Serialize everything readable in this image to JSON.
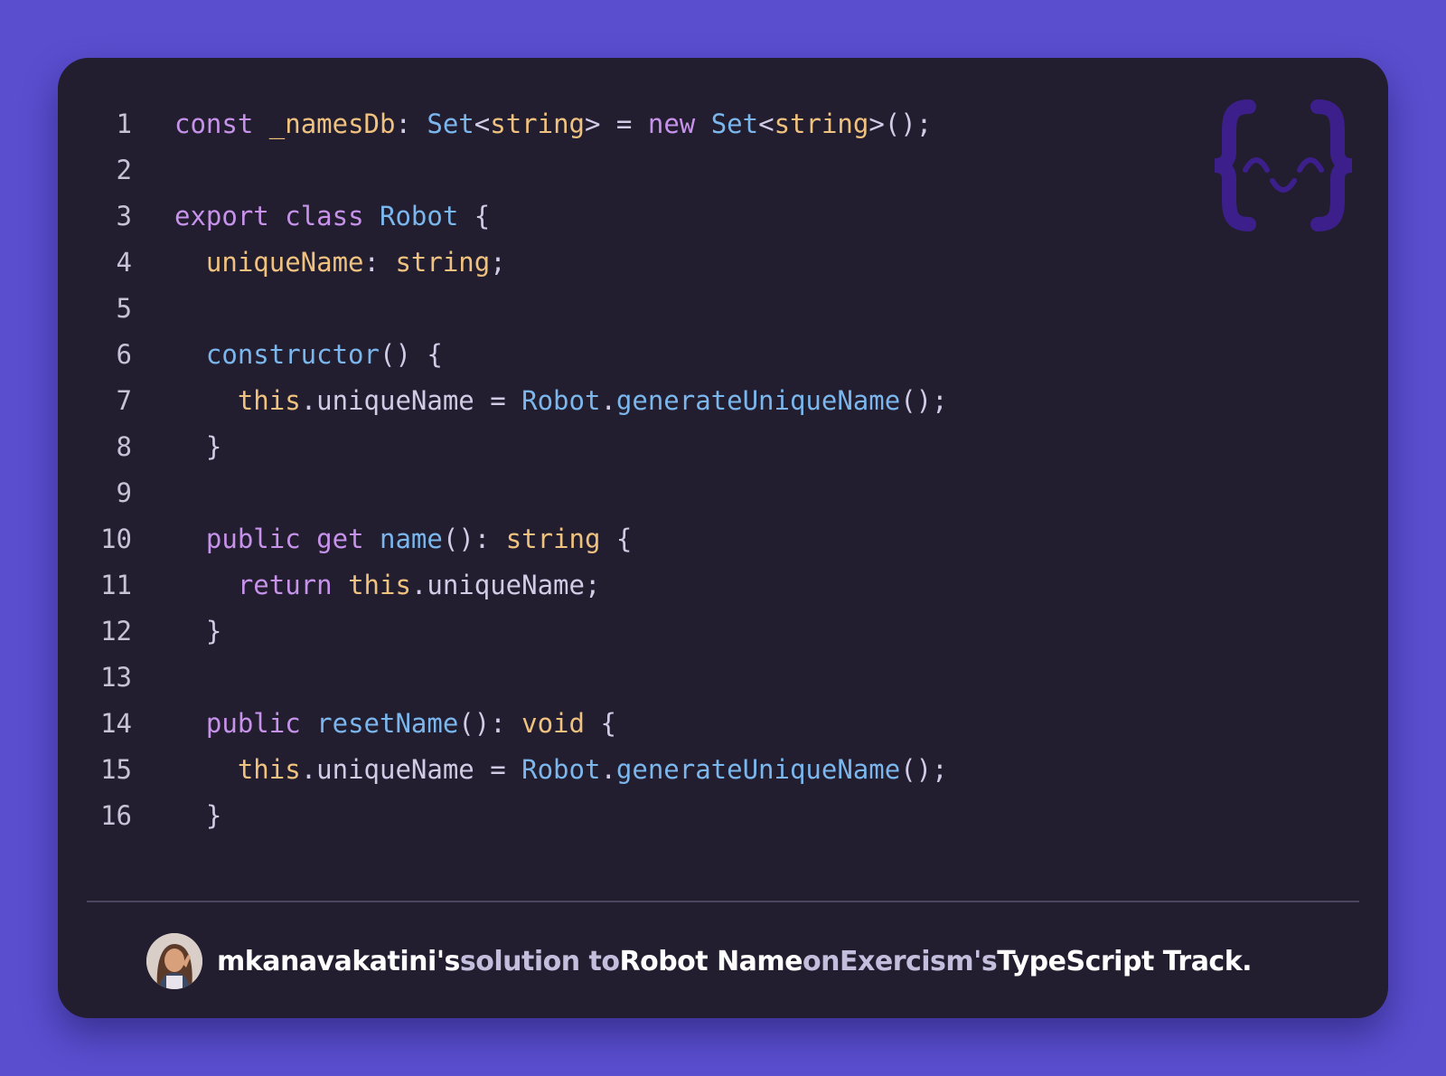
{
  "code": {
    "lines": [
      {
        "n": "1",
        "tokens": [
          {
            "c": "kw",
            "t": "const"
          },
          {
            "c": "pl",
            "t": " "
          },
          {
            "c": "prop",
            "t": "_namesDb"
          },
          {
            "c": "pl",
            "t": ": "
          },
          {
            "c": "ty",
            "t": "Set"
          },
          {
            "c": "pl",
            "t": "<"
          },
          {
            "c": "prop",
            "t": "string"
          },
          {
            "c": "pl",
            "t": "> = "
          },
          {
            "c": "kw",
            "t": "new"
          },
          {
            "c": "pl",
            "t": " "
          },
          {
            "c": "ty",
            "t": "Set"
          },
          {
            "c": "pl",
            "t": "<"
          },
          {
            "c": "prop",
            "t": "string"
          },
          {
            "c": "pl",
            "t": ">();"
          }
        ]
      },
      {
        "n": "2",
        "tokens": []
      },
      {
        "n": "3",
        "tokens": [
          {
            "c": "kw",
            "t": "export"
          },
          {
            "c": "pl",
            "t": " "
          },
          {
            "c": "kw",
            "t": "class"
          },
          {
            "c": "pl",
            "t": " "
          },
          {
            "c": "ty",
            "t": "Robot"
          },
          {
            "c": "pl",
            "t": " {"
          }
        ]
      },
      {
        "n": "4",
        "tokens": [
          {
            "c": "pl",
            "t": "  "
          },
          {
            "c": "prop",
            "t": "uniqueName"
          },
          {
            "c": "pl",
            "t": ": "
          },
          {
            "c": "prop",
            "t": "string"
          },
          {
            "c": "pl",
            "t": ";"
          }
        ]
      },
      {
        "n": "5",
        "tokens": []
      },
      {
        "n": "6",
        "tokens": [
          {
            "c": "pl",
            "t": "  "
          },
          {
            "c": "fn",
            "t": "constructor"
          },
          {
            "c": "pl",
            "t": "() {"
          }
        ]
      },
      {
        "n": "7",
        "tokens": [
          {
            "c": "pl",
            "t": "    "
          },
          {
            "c": "prop",
            "t": "this"
          },
          {
            "c": "pl",
            "t": ".uniqueName = "
          },
          {
            "c": "ty",
            "t": "Robot"
          },
          {
            "c": "pl",
            "t": "."
          },
          {
            "c": "fn",
            "t": "generateUniqueName"
          },
          {
            "c": "pl",
            "t": "();"
          }
        ]
      },
      {
        "n": "8",
        "tokens": [
          {
            "c": "pl",
            "t": "  }"
          }
        ]
      },
      {
        "n": "9",
        "tokens": []
      },
      {
        "n": "10",
        "tokens": [
          {
            "c": "pl",
            "t": "  "
          },
          {
            "c": "kw",
            "t": "public"
          },
          {
            "c": "pl",
            "t": " "
          },
          {
            "c": "kw",
            "t": "get"
          },
          {
            "c": "pl",
            "t": " "
          },
          {
            "c": "fn",
            "t": "name"
          },
          {
            "c": "pl",
            "t": "(): "
          },
          {
            "c": "prop",
            "t": "string"
          },
          {
            "c": "pl",
            "t": " {"
          }
        ]
      },
      {
        "n": "11",
        "tokens": [
          {
            "c": "pl",
            "t": "    "
          },
          {
            "c": "kw",
            "t": "return"
          },
          {
            "c": "pl",
            "t": " "
          },
          {
            "c": "prop",
            "t": "this"
          },
          {
            "c": "pl",
            "t": ".uniqueName;"
          }
        ]
      },
      {
        "n": "12",
        "tokens": [
          {
            "c": "pl",
            "t": "  }"
          }
        ]
      },
      {
        "n": "13",
        "tokens": []
      },
      {
        "n": "14",
        "tokens": [
          {
            "c": "pl",
            "t": "  "
          },
          {
            "c": "kw",
            "t": "public"
          },
          {
            "c": "pl",
            "t": " "
          },
          {
            "c": "fn",
            "t": "resetName"
          },
          {
            "c": "pl",
            "t": "(): "
          },
          {
            "c": "prop",
            "t": "void"
          },
          {
            "c": "pl",
            "t": " {"
          }
        ]
      },
      {
        "n": "15",
        "tokens": [
          {
            "c": "pl",
            "t": "    "
          },
          {
            "c": "prop",
            "t": "this"
          },
          {
            "c": "pl",
            "t": ".uniqueName = "
          },
          {
            "c": "ty",
            "t": "Robot"
          },
          {
            "c": "pl",
            "t": "."
          },
          {
            "c": "fn",
            "t": "generateUniqueName"
          },
          {
            "c": "pl",
            "t": "();"
          }
        ]
      },
      {
        "n": "16",
        "tokens": [
          {
            "c": "pl",
            "t": "  }"
          }
        ]
      }
    ]
  },
  "footer": {
    "author": "mkanavakatini",
    "possessive1": "'s",
    "solution_to": " solution to ",
    "exercise": "Robot Name",
    "on": " on ",
    "site": "Exercism",
    "possessive2": "'s",
    "track": " TypeScript Track."
  },
  "icons": {
    "logo": "exercism-logo-icon",
    "avatar": "user-avatar"
  },
  "colors": {
    "background": "#5a4ecf",
    "card": "#221e30",
    "keyword": "#c792ea",
    "type": "#7bb6ec",
    "property": "#f0c27f",
    "plain": "#d1cbe5",
    "logo": "#3d1f8c"
  }
}
